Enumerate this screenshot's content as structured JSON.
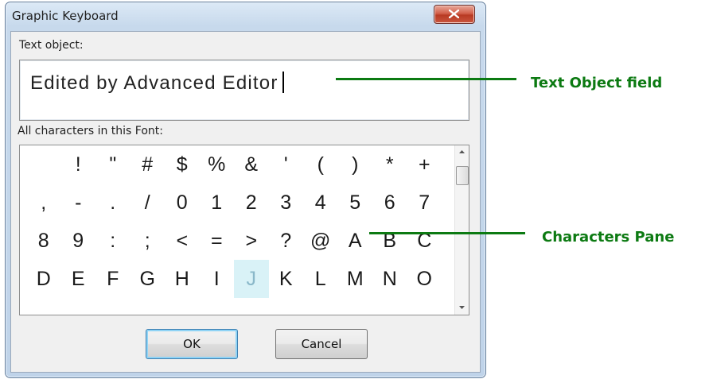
{
  "window": {
    "title": "Graphic Keyboard",
    "close_icon": "close-icon"
  },
  "text_object": {
    "label": "Text object:",
    "value": "Edited by Advanced Editor"
  },
  "characters": {
    "label": "All characters in this Font:",
    "rows": [
      [
        " ",
        "!",
        "\"",
        "#",
        "$",
        "%",
        "&",
        "'",
        "(",
        ")",
        "*",
        "+"
      ],
      [
        ",",
        "-",
        ".",
        "/",
        "0",
        "1",
        "2",
        "3",
        "4",
        "5",
        "6",
        "7"
      ],
      [
        "8",
        "9",
        ":",
        ";",
        "<",
        "=",
        ">",
        "?",
        "@",
        "A",
        "B",
        "C"
      ],
      [
        "D",
        "E",
        "F",
        "G",
        "H",
        "I",
        "J",
        "K",
        "L",
        "M",
        "N",
        "O"
      ]
    ],
    "selected": "J"
  },
  "buttons": {
    "ok": "OK",
    "cancel": "Cancel"
  },
  "annotations": {
    "text_object_field": "Text Object field",
    "characters_pane": "Characters Pane",
    "color": "#0c7a12"
  }
}
